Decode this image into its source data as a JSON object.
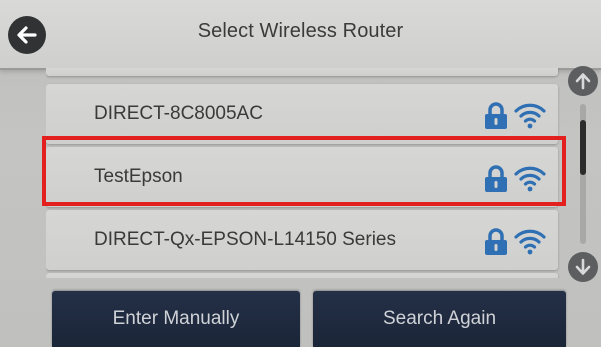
{
  "header": {
    "title": "Select Wireless Router",
    "back_icon": "arrow-left-icon"
  },
  "networks": [
    {
      "ssid": "DIRECT-8C8005AC",
      "secured": true,
      "signal": "full"
    },
    {
      "ssid": "TestEpson",
      "secured": true,
      "signal": "full",
      "highlighted": true
    },
    {
      "ssid": "DIRECT-Qx-EPSON-L14150 Series",
      "secured": true,
      "signal": "full"
    }
  ],
  "scrollbar": {
    "up_icon": "arrow-up-icon",
    "down_icon": "arrow-down-icon"
  },
  "buttons": {
    "enter_manually": "Enter Manually",
    "search_again": "Search Again"
  },
  "colors": {
    "highlight": "#e3201d",
    "lock": "#2f6fb3",
    "wifi": "#2f6fb3",
    "button_bg": "#1f2a3f"
  }
}
